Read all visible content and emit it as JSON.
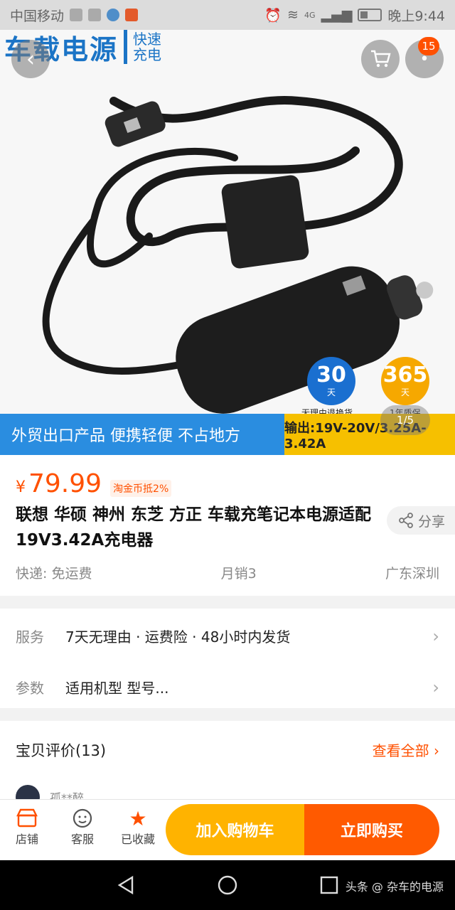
{
  "status_bar": {
    "carrier": "中国移动",
    "network": "4G",
    "time": "晚上9:44"
  },
  "hero": {
    "title": "车载电源",
    "subtitle_line1": "快速",
    "subtitle_line2": "充电",
    "cart_badge": "15",
    "promo_30_num": "30",
    "promo_30_unit": "天",
    "promo_30_label": "无理由退换货",
    "promo_365_num": "365",
    "promo_365_unit": "天",
    "promo_365_label": "1年质保",
    "ribbon_left": "外贸出口产品 便携轻便 不占地方",
    "ribbon_right": "输出:19V-20V/3.25A-3.42A",
    "pager": "1/5",
    "colors": {
      "brand_blue": "#1b74c6",
      "ribbon_blue": "#2a8de0",
      "ribbon_yellow": "#f6c000"
    }
  },
  "product": {
    "currency": "¥",
    "price": "79.99",
    "coin_tag": "淘金币抵2%",
    "title": "联想 华硕 神州 东芝 方正 车载充笔记本电源适配 19V3.42A充电器",
    "share": "分享",
    "shipping": "快递: 免运费",
    "monthly_sales": "月销3",
    "location": "广东深圳",
    "accent": "#ff5000"
  },
  "details": {
    "service_label": "服务",
    "service_value": "7天无理由 · 运费险 · 48小时内发货",
    "params_label": "参数",
    "params_value": "适用机型 型号..."
  },
  "reviews": {
    "title": "宝贝评价(13)",
    "view_all": "查看全部",
    "first_reviewer": "孤**醉"
  },
  "bottom_bar": {
    "store": "店铺",
    "service": "客服",
    "favorited": "已收藏",
    "add_to_cart": "加入购物车",
    "buy_now": "立即购买"
  },
  "watermark": "头条 @ 杂车的电源"
}
